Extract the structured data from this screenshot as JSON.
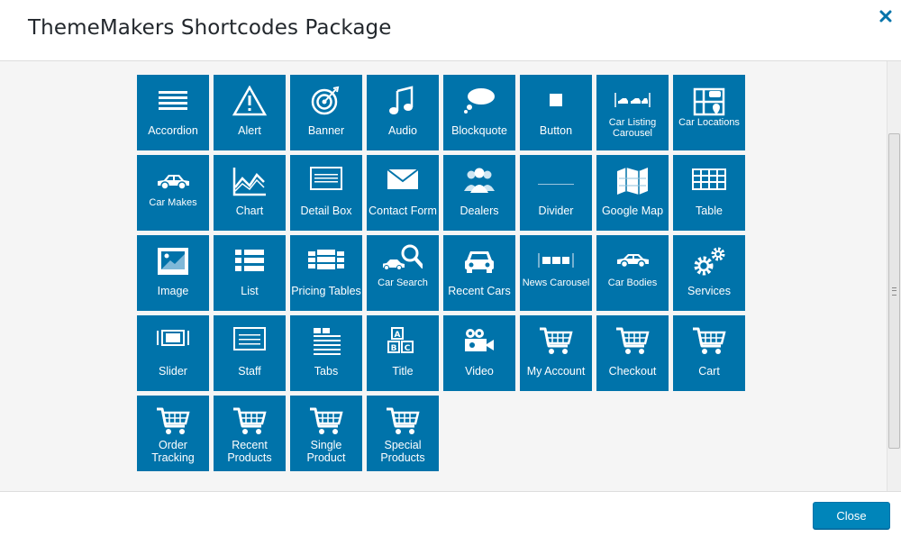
{
  "dialog": {
    "title": "ThemeMakers Shortcodes Package",
    "close_icon": "close-x-icon",
    "accent": "#0073aa"
  },
  "shortcodes": [
    {
      "label": "Accordion",
      "icon": "accordion-icon"
    },
    {
      "label": "Alert",
      "icon": "alert-icon"
    },
    {
      "label": "Banner",
      "icon": "banner-icon"
    },
    {
      "label": "Audio",
      "icon": "audio-icon"
    },
    {
      "label": "Blockquote",
      "icon": "blockquote-icon"
    },
    {
      "label": "Button",
      "icon": "button-icon"
    },
    {
      "label": "Car Listing Carousel",
      "icon": "car-listing-carousel-icon"
    },
    {
      "label": "Car Locations",
      "icon": "car-locations-icon"
    },
    {
      "label": "Car Makes",
      "icon": "car-makes-icon"
    },
    {
      "label": "Chart",
      "icon": "chart-icon"
    },
    {
      "label": "Detail Box",
      "icon": "detail-box-icon"
    },
    {
      "label": "Contact Form",
      "icon": "contact-form-icon"
    },
    {
      "label": "Dealers",
      "icon": "dealers-icon"
    },
    {
      "label": "Divider",
      "icon": "divider-icon"
    },
    {
      "label": "Google Map",
      "icon": "google-map-icon"
    },
    {
      "label": "Table",
      "icon": "table-icon"
    },
    {
      "label": "Image",
      "icon": "image-icon"
    },
    {
      "label": "List",
      "icon": "list-icon"
    },
    {
      "label": "Pricing Tables",
      "icon": "pricing-tables-icon"
    },
    {
      "label": "Car Search",
      "icon": "car-search-icon"
    },
    {
      "label": "Recent Cars",
      "icon": "recent-cars-icon"
    },
    {
      "label": "News Carousel",
      "icon": "news-carousel-icon"
    },
    {
      "label": "Car Bodies",
      "icon": "car-bodies-icon"
    },
    {
      "label": "Services",
      "icon": "services-icon"
    },
    {
      "label": "Slider",
      "icon": "slider-icon"
    },
    {
      "label": "Staff",
      "icon": "staff-icon"
    },
    {
      "label": "Tabs",
      "icon": "tabs-icon"
    },
    {
      "label": "Title",
      "icon": "title-icon"
    },
    {
      "label": "Video",
      "icon": "video-icon"
    },
    {
      "label": "My Account",
      "icon": "cart-icon"
    },
    {
      "label": "Checkout",
      "icon": "cart-icon"
    },
    {
      "label": "Cart",
      "icon": "cart-icon"
    },
    {
      "label": "Order Tracking",
      "icon": "cart-icon"
    },
    {
      "label": "Recent Products",
      "icon": "cart-icon"
    },
    {
      "label": "Single Product",
      "icon": "cart-icon"
    },
    {
      "label": "Special Products",
      "icon": "cart-icon"
    }
  ],
  "footer": {
    "close_label": "Close"
  }
}
